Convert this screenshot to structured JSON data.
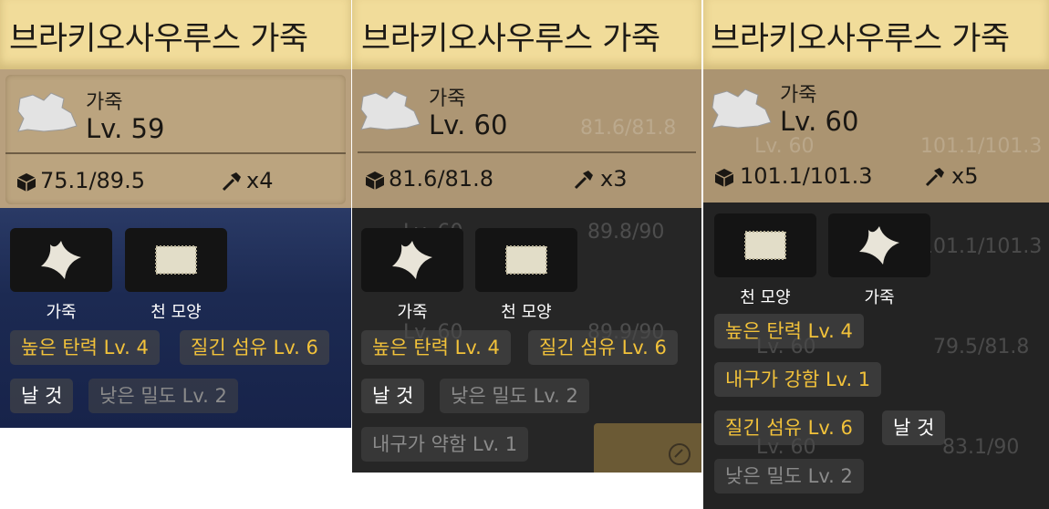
{
  "cards": [
    {
      "title": "브라키오사우루스 가죽",
      "type_label": "가죽",
      "level": "Lv. 59",
      "durability": "75.1/89.5",
      "count": "x4",
      "slots": [
        {
          "label": "가죽",
          "icon": "leather-piece-icon"
        },
        {
          "label": "천 모양",
          "icon": "cloth-icon"
        }
      ],
      "tags": [
        {
          "text": "높은 탄력 Lv. 4",
          "style": "gold"
        },
        {
          "text": "질긴 섬유 Lv. 6",
          "style": "gold"
        },
        {
          "text": "날 것",
          "style": "white"
        },
        {
          "text": "낮은 밀도 Lv. 2",
          "style": "dim"
        }
      ]
    },
    {
      "title": "브라키오사우루스 가죽",
      "type_label": "가죽",
      "level": "Lv. 60",
      "durability": "81.6/81.8",
      "count": "x3",
      "slots": [
        {
          "label": "가죽",
          "icon": "leather-piece-icon"
        },
        {
          "label": "천 모양",
          "icon": "cloth-icon"
        }
      ],
      "tags": [
        {
          "text": "높은 탄력 Lv. 4",
          "style": "gold"
        },
        {
          "text": "질긴 섬유 Lv. 6",
          "style": "gold"
        },
        {
          "text": "날 것",
          "style": "white"
        },
        {
          "text": "낮은 밀도 Lv. 2",
          "style": "dim"
        },
        {
          "text": "내구가 약함 Lv. 1",
          "style": "dim"
        }
      ],
      "ghost_text": [
        "81.6/81.8",
        "Lv. 60",
        "89.8/90",
        "Lv. 60",
        "89.9/90"
      ]
    },
    {
      "title": "브라키오사우루스 가죽",
      "type_label": "가죽",
      "level": "Lv. 60",
      "durability": "101.1/101.3",
      "count": "x5",
      "slots": [
        {
          "label": "천 모양",
          "icon": "cloth-icon"
        },
        {
          "label": "가죽",
          "icon": "leather-piece-icon"
        }
      ],
      "tags": [
        {
          "text": "높은 탄력 Lv. 4",
          "style": "gold"
        },
        {
          "text": "내구가 강함 Lv. 1",
          "style": "gold"
        },
        {
          "text": "질긴 섬유 Lv. 6",
          "style": "gold"
        },
        {
          "text": "날 것",
          "style": "white"
        },
        {
          "text": "낮은 밀도 Lv. 2",
          "style": "dim"
        }
      ],
      "ghost_text": [
        "Lv. 60",
        "101.1/101.3",
        "60",
        "101.1/101.3",
        "Lv. 60",
        "79.5/81.8",
        "Lv. 60",
        "83.1/90"
      ]
    }
  ],
  "colors": {
    "title_bg": "#f1dc9a",
    "info_bg": "#b8a07e",
    "gold_text": "#f2c23a",
    "card1_lower_bg": "#1c2a52",
    "card2_lower_bg": "#262626",
    "card3_lower_bg": "#232323"
  }
}
